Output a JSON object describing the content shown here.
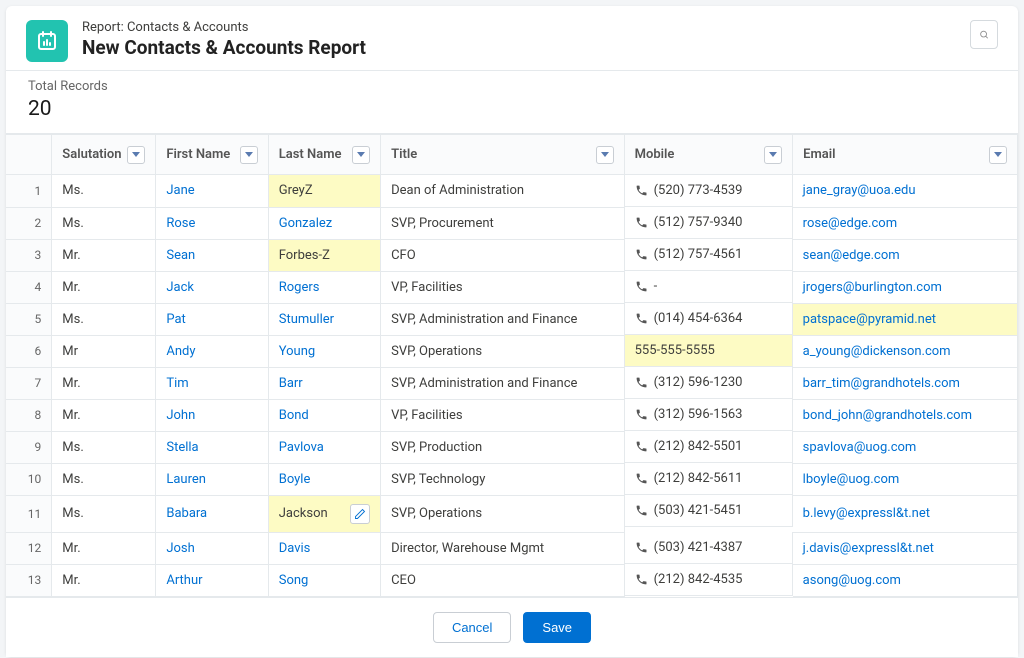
{
  "header": {
    "subtitle": "Report: Contacts & Accounts",
    "title": "New Contacts & Accounts Report"
  },
  "totals": {
    "label": "Total Records",
    "value": "20"
  },
  "columns": {
    "salutation": "Salutation",
    "firstName": "First Name",
    "lastName": "Last Name",
    "title": "Title",
    "mobile": "Mobile",
    "email": "Email"
  },
  "footer": {
    "cancel": "Cancel",
    "save": "Save"
  },
  "rows": [
    {
      "n": "1",
      "sal": "Ms.",
      "fn": "Jane",
      "ln": "GreyZ",
      "lnHl": true,
      "title": "Dean of Administration",
      "mob": "(520) 773-4539",
      "email": "jane_gray@uoa.edu"
    },
    {
      "n": "2",
      "sal": "Ms.",
      "fn": "Rose",
      "ln": "Gonzalez",
      "lnLink": true,
      "title": "SVP, Procurement",
      "mob": "(512) 757-9340",
      "email": "rose@edge.com"
    },
    {
      "n": "3",
      "sal": "Mr.",
      "fn": "Sean",
      "ln": "Forbes-Z",
      "lnHl": true,
      "title": "CFO",
      "mob": "(512) 757-4561",
      "email": "sean@edge.com"
    },
    {
      "n": "4",
      "sal": "Mr.",
      "fn": "Jack",
      "ln": "Rogers",
      "lnLink": true,
      "title": "VP, Facilities",
      "mob": "-",
      "email": "jrogers@burlington.com"
    },
    {
      "n": "5",
      "sal": "Ms.",
      "fn": "Pat",
      "ln": "Stumuller",
      "lnLink": true,
      "title": "SVP, Administration and Finance",
      "mob": "(014) 454-6364",
      "email": "patspace@pyramid.net",
      "emailHl": true
    },
    {
      "n": "6",
      "sal": "Mr",
      "fn": "Andy",
      "ln": "Young",
      "lnLink": true,
      "title": "SVP, Operations",
      "mob": "555-555-5555",
      "mobHl": true,
      "noIcon": true,
      "email": "a_young@dickenson.com"
    },
    {
      "n": "7",
      "sal": "Mr.",
      "fn": "Tim",
      "ln": "Barr",
      "lnLink": true,
      "title": "SVP, Administration and Finance",
      "mob": "(312) 596-1230",
      "email": "barr_tim@grandhotels.com"
    },
    {
      "n": "8",
      "sal": "Mr.",
      "fn": "John",
      "ln": "Bond",
      "lnLink": true,
      "title": "VP, Facilities",
      "mob": "(312) 596-1563",
      "email": "bond_john@grandhotels.com"
    },
    {
      "n": "9",
      "sal": "Ms.",
      "fn": "Stella",
      "ln": "Pavlova",
      "lnLink": true,
      "title": "SVP, Production",
      "mob": "(212) 842-5501",
      "email": "spavlova@uog.com"
    },
    {
      "n": "10",
      "sal": "Ms.",
      "fn": "Lauren",
      "ln": "Boyle",
      "lnLink": true,
      "title": "SVP, Technology",
      "mob": "(212) 842-5611",
      "email": "lboyle@uog.com"
    },
    {
      "n": "11",
      "sal": "Ms.",
      "fn": "Babara",
      "ln": "Jackson",
      "lnHl": true,
      "editing": true,
      "title": "SVP, Operations",
      "mob": "(503) 421-5451",
      "email": "b.levy@expressl&t.net"
    },
    {
      "n": "12",
      "sal": "Mr.",
      "fn": "Josh",
      "ln": "Davis",
      "lnLink": true,
      "title": "Director, Warehouse Mgmt",
      "mob": "(503) 421-4387",
      "email": "j.davis@expressl&t.net"
    },
    {
      "n": "13",
      "sal": "Mr.",
      "fn": "Arthur",
      "ln": "Song",
      "lnLink": true,
      "title": "CEO",
      "mob": "(212) 842-4535",
      "email": "asong@uog.com"
    }
  ]
}
